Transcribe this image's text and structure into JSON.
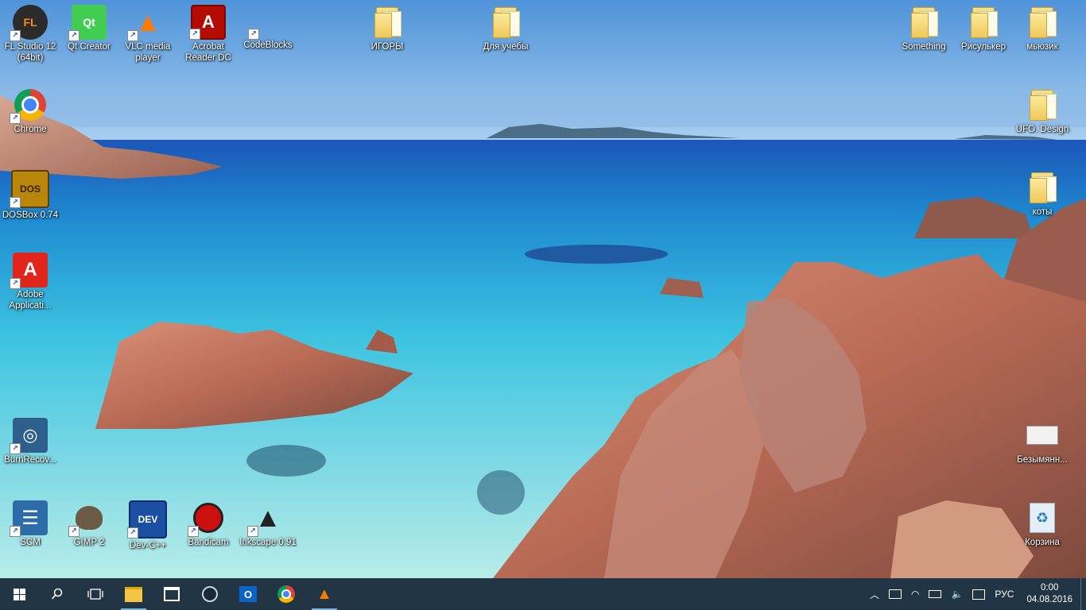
{
  "desktop": {
    "icons": [
      {
        "label": "FL Studio 12 (64bit)",
        "icon": "fl-studio-icon",
        "glyph": "FL",
        "color": "#ff8a1e"
      },
      {
        "label": "Qt Creator",
        "icon": "qt-creator-icon",
        "glyph": "Qt",
        "color": "#41cd52"
      },
      {
        "label": "VLC media player",
        "icon": "vlc-icon",
        "glyph": "▲",
        "color": "#ff7b00"
      },
      {
        "label": "Acrobat Reader DC",
        "icon": "acrobat-reader-icon",
        "glyph": "A",
        "color": "#b30b00"
      },
      {
        "label": "CodeBlocks",
        "icon": "codeblocks-icon",
        "glyph": "■",
        "color": "#5b9b2e"
      },
      {
        "label": "ИГОРЫ",
        "icon": "folder-icon"
      },
      {
        "label": "Для учебы",
        "icon": "folder-icon"
      },
      {
        "label": "Something",
        "icon": "folder-icon"
      },
      {
        "label": "Рисулькер",
        "icon": "folder-icon"
      },
      {
        "label": "мьюзик",
        "icon": "folder-icon"
      },
      {
        "label": "Chrome",
        "icon": "chrome-icon",
        "glyph": "●",
        "color": "#db4437"
      },
      {
        "label": "UFO. Design",
        "icon": "folder-icon"
      },
      {
        "label": "DOSBox 0.74",
        "icon": "dosbox-icon",
        "glyph": "DOS",
        "color": "#b8860b"
      },
      {
        "label": "коты",
        "icon": "folder-icon"
      },
      {
        "label": "Adobe Applicati...",
        "icon": "adobe-application-icon",
        "glyph": "A",
        "color": "#e1251b"
      },
      {
        "label": "BurnRecov...",
        "icon": "burnrecovery-icon",
        "glyph": "◎",
        "color": "#2e5f8c"
      },
      {
        "label": "Безымянн...",
        "icon": "image-file-icon",
        "glyph": "▭",
        "color": "#dddddd"
      },
      {
        "label": "SCM",
        "icon": "scm-icon",
        "glyph": "☰",
        "color": "#2d6ca8"
      },
      {
        "label": "GIMP 2",
        "icon": "gimp-icon",
        "glyph": "🐺",
        "color": "#6b5a44"
      },
      {
        "label": "Dev-C++",
        "icon": "devcpp-icon",
        "glyph": "DEV",
        "color": "#1a4fa3"
      },
      {
        "label": "Bandicam",
        "icon": "bandicam-icon",
        "glyph": "●",
        "color": "#cc1010"
      },
      {
        "label": "Inkscape 0.91",
        "icon": "inkscape-icon",
        "glyph": "▲",
        "color": "#222222"
      },
      {
        "label": "Корзина",
        "icon": "recycle-bin-icon",
        "glyph": "♻",
        "color": "#d8e6f0"
      }
    ]
  },
  "taskbar": {
    "start": "start-icon",
    "search": "search-icon",
    "task_view": "task-view-icon",
    "pinned": [
      {
        "name": "file-explorer-icon",
        "glyph": "📁"
      },
      {
        "name": "store-icon",
        "glyph": "⊞"
      },
      {
        "name": "steam-icon",
        "glyph": "◉"
      },
      {
        "name": "outlook-icon",
        "glyph": "O"
      },
      {
        "name": "chrome-icon",
        "glyph": "●"
      },
      {
        "name": "vlc-icon",
        "glyph": "▲"
      }
    ],
    "tray": {
      "language": "РУС",
      "time": "0:00",
      "date": "04.08.2016"
    }
  }
}
